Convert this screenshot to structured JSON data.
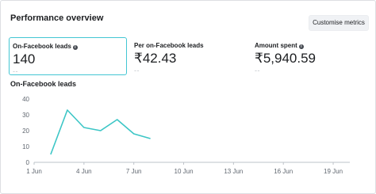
{
  "header": {
    "title": "Performance overview",
    "customise_label": "Customise metrics"
  },
  "metrics": [
    {
      "label": "On-Facebook leads",
      "value": "140",
      "change": "--",
      "has_info": true
    },
    {
      "label": "Per on-Facebook leads",
      "value": "₹42.43",
      "change": "--",
      "has_info": false
    },
    {
      "label": "Amount spent",
      "value": "₹5,940.59",
      "change": "--",
      "has_info": true
    }
  ],
  "chart_title": "On-Facebook leads",
  "colors": {
    "line": "#3cc6c6",
    "selected_border": "#43c6d3"
  },
  "chart_data": {
    "type": "line",
    "title": "On-Facebook leads",
    "xlabel": "",
    "ylabel": "",
    "x_ticks": [
      "1 Jun",
      "4 Jun",
      "7 Jun",
      "10 Jun",
      "13 Jun",
      "16 Jun",
      "19 Jun"
    ],
    "y_ticks": [
      0,
      10,
      20,
      30,
      40
    ],
    "ylim": [
      0,
      40
    ],
    "xlim_days": [
      1,
      20
    ],
    "series": [
      {
        "x": [
          2,
          3,
          4,
          5,
          6,
          7,
          8
        ],
        "y": [
          5,
          33,
          22,
          20,
          27,
          18,
          15
        ]
      }
    ],
    "grid": false
  }
}
